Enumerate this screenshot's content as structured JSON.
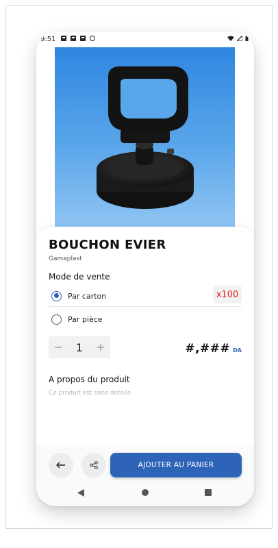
{
  "statusbar": {
    "time": "9:51"
  },
  "product": {
    "name": "BOUCHON EVIER",
    "brand": "Gamaplast"
  },
  "sale_mode": {
    "label": "Mode de vente",
    "options": [
      {
        "label": "Par carton",
        "selected": true
      },
      {
        "label": "Par pièce",
        "selected": false
      }
    ],
    "carton_quantity": "x100"
  },
  "quantity": {
    "value": "1",
    "minus_icon": "minus-icon",
    "plus_icon": "plus-icon"
  },
  "price": {
    "value": "#,###",
    "currency": "DA"
  },
  "about": {
    "title": "A propos du produit",
    "text": "Ce produit est sans details"
  },
  "actions": {
    "back_icon": "arrow-left-icon",
    "share_icon": "share-icon",
    "add_to_cart": "AJOUTER AU PANIER"
  },
  "colors": {
    "accent": "#2e64b8",
    "badge_text": "#e02020",
    "image_bg": "#5aa6ea"
  }
}
